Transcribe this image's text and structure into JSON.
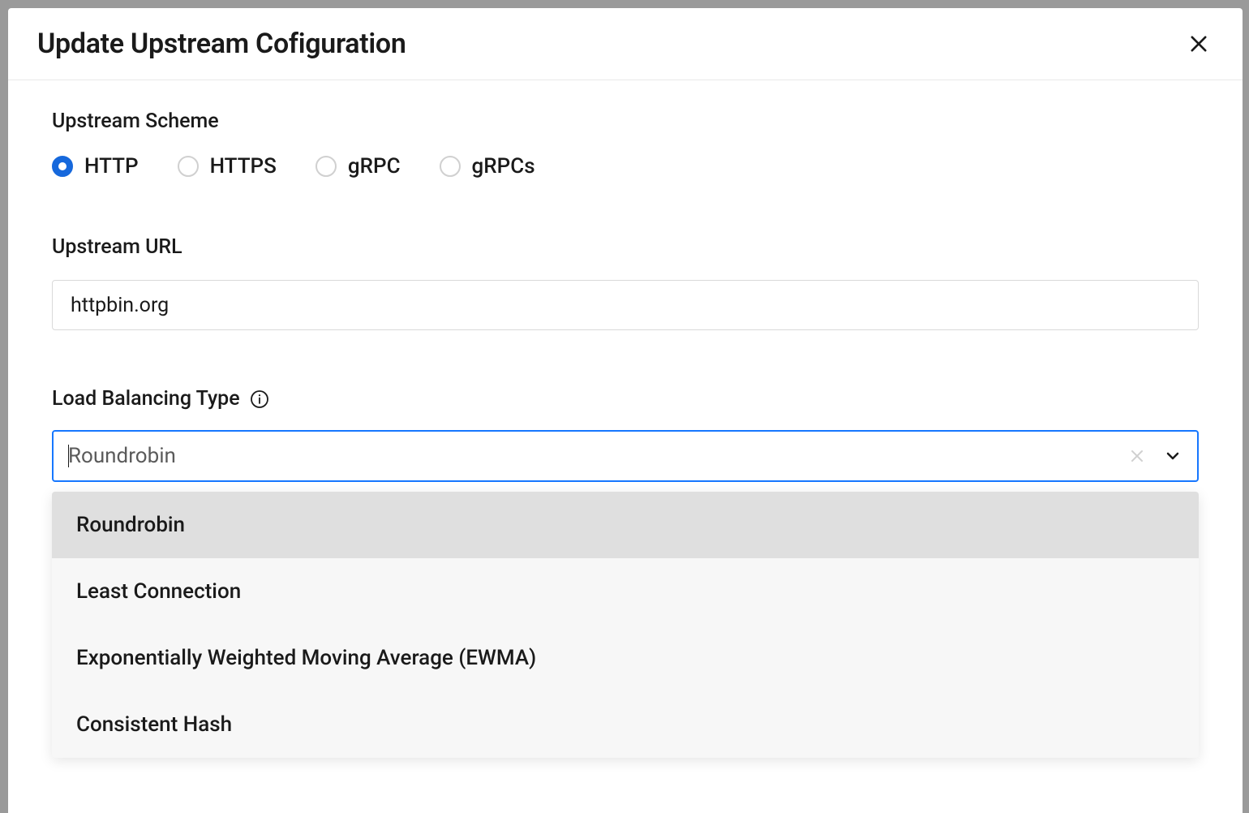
{
  "modal": {
    "title": "Update Upstream Cofiguration"
  },
  "scheme": {
    "label": "Upstream Scheme",
    "options": [
      {
        "label": "HTTP",
        "selected": true
      },
      {
        "label": "HTTPS",
        "selected": false
      },
      {
        "label": "gRPC",
        "selected": false
      },
      {
        "label": "gRPCs",
        "selected": false
      }
    ]
  },
  "url": {
    "label": "Upstream URL",
    "value": "httpbin.org"
  },
  "loadBalancing": {
    "label": "Load Balancing Type",
    "selected": "Roundrobin",
    "options": [
      "Roundrobin",
      "Least Connection",
      "Exponentially Weighted Moving Average (EWMA)",
      "Consistent Hash"
    ]
  }
}
